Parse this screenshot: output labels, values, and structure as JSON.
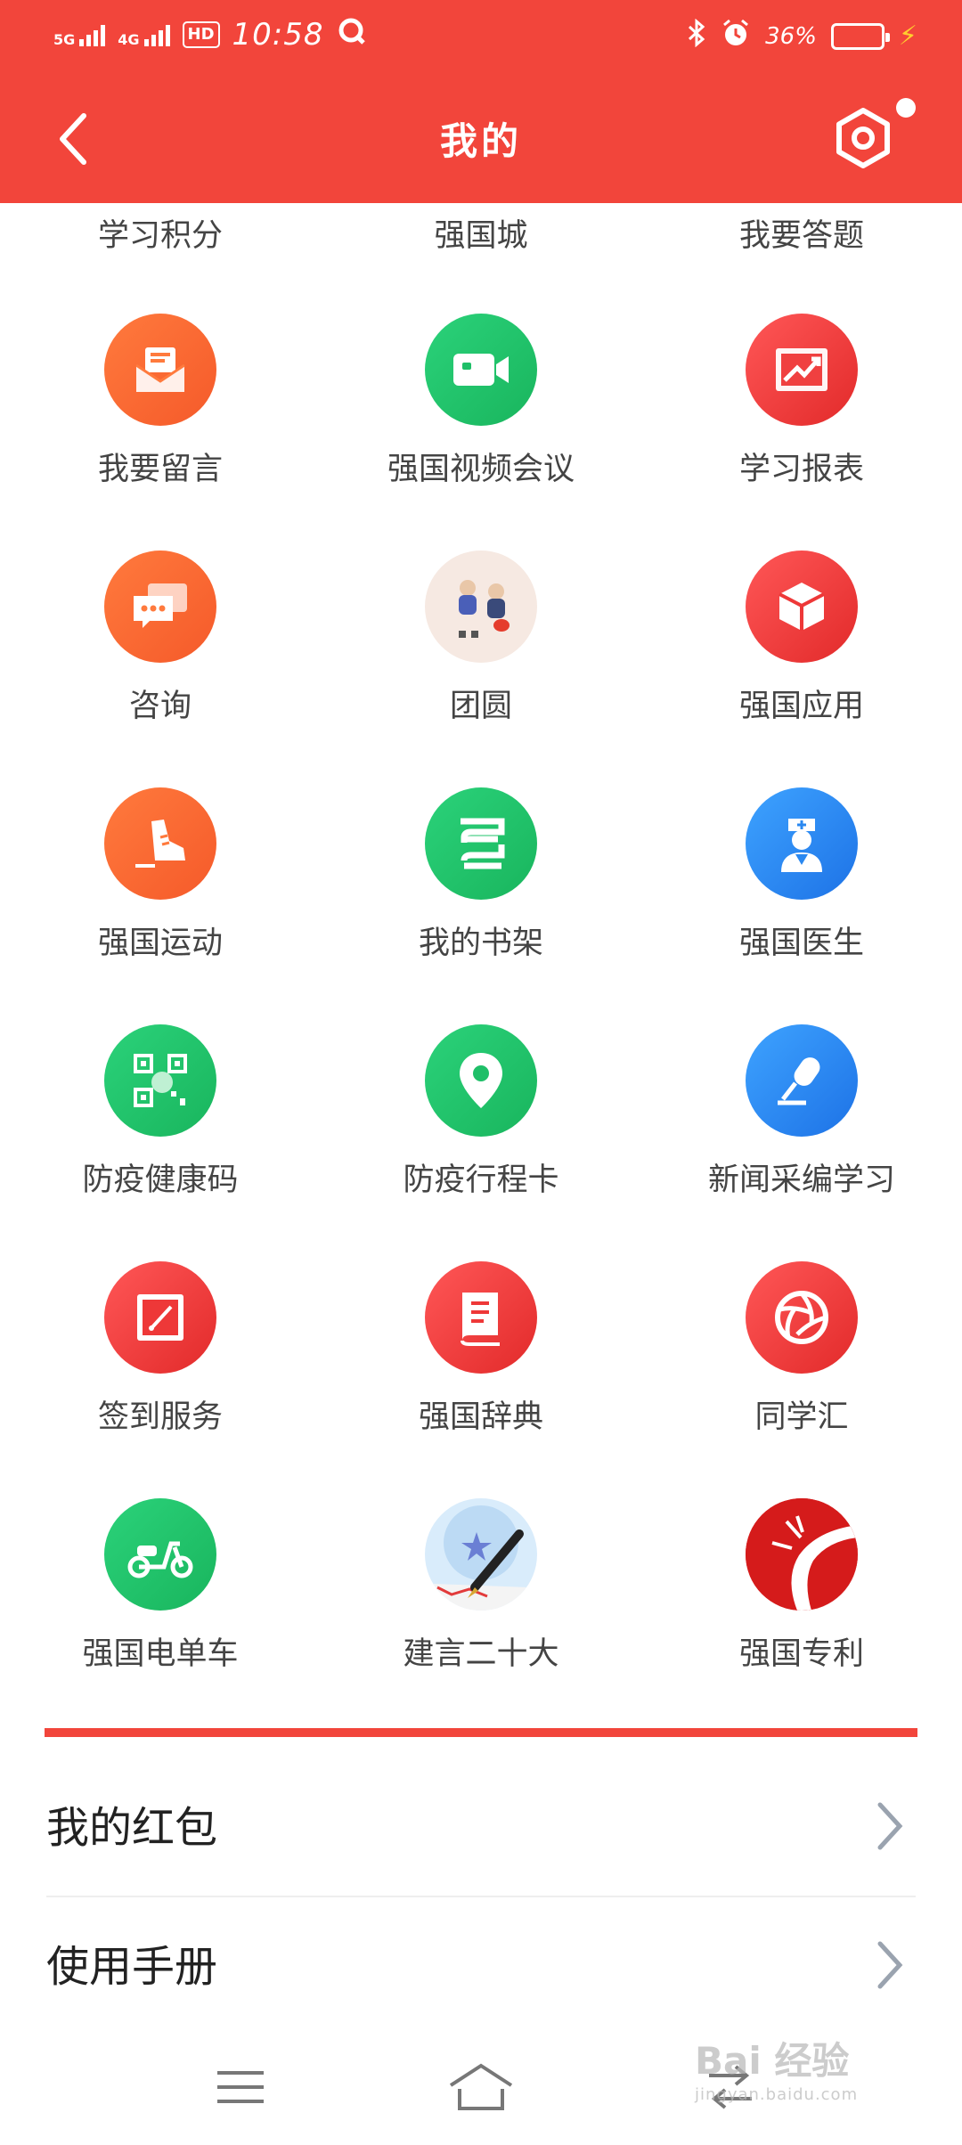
{
  "status_bar": {
    "net1": "5G",
    "net2": "4G",
    "hd": "HD",
    "time": "10:58",
    "battery": "36%",
    "battery_level": 0.36
  },
  "header": {
    "title": "我的",
    "colors": {
      "brand": "#f2453b"
    }
  },
  "partial_row": [
    "学习积分",
    "强国城",
    "我要答题"
  ],
  "grid": [
    [
      {
        "label": "我要留言",
        "icon": "mail-icon"
      },
      {
        "label": "强国视频会议",
        "icon": "video-camera-icon"
      },
      {
        "label": "学习报表",
        "icon": "chart-icon"
      }
    ],
    [
      {
        "label": "咨询",
        "icon": "chat-icon"
      },
      {
        "label": "团圆",
        "icon": "reunion-illustration-icon"
      },
      {
        "label": "强国应用",
        "icon": "box-icon"
      }
    ],
    [
      {
        "label": "强国运动",
        "icon": "shoe-icon"
      },
      {
        "label": "我的书架",
        "icon": "bookshelf-icon"
      },
      {
        "label": "强国医生",
        "icon": "doctor-icon"
      }
    ],
    [
      {
        "label": "防疫健康码",
        "icon": "qr-code-icon"
      },
      {
        "label": "防疫行程卡",
        "icon": "location-pin-icon"
      },
      {
        "label": "新闻采编学习",
        "icon": "microphone-icon"
      }
    ],
    [
      {
        "label": "签到服务",
        "icon": "signin-icon"
      },
      {
        "label": "强国辞典",
        "icon": "dictionary-icon"
      },
      {
        "label": "同学汇",
        "icon": "aperture-icon"
      }
    ],
    [
      {
        "label": "强国电单车",
        "icon": "scooter-icon"
      },
      {
        "label": "建言二十大",
        "icon": "pen-star-icon"
      },
      {
        "label": "强国专利",
        "icon": "patent-icon"
      }
    ]
  ],
  "list": [
    {
      "label": "我的红包"
    },
    {
      "label": "使用手册"
    }
  ],
  "watermark": {
    "text": "Bai 经验",
    "sub": "jingyan.baidu.com"
  }
}
